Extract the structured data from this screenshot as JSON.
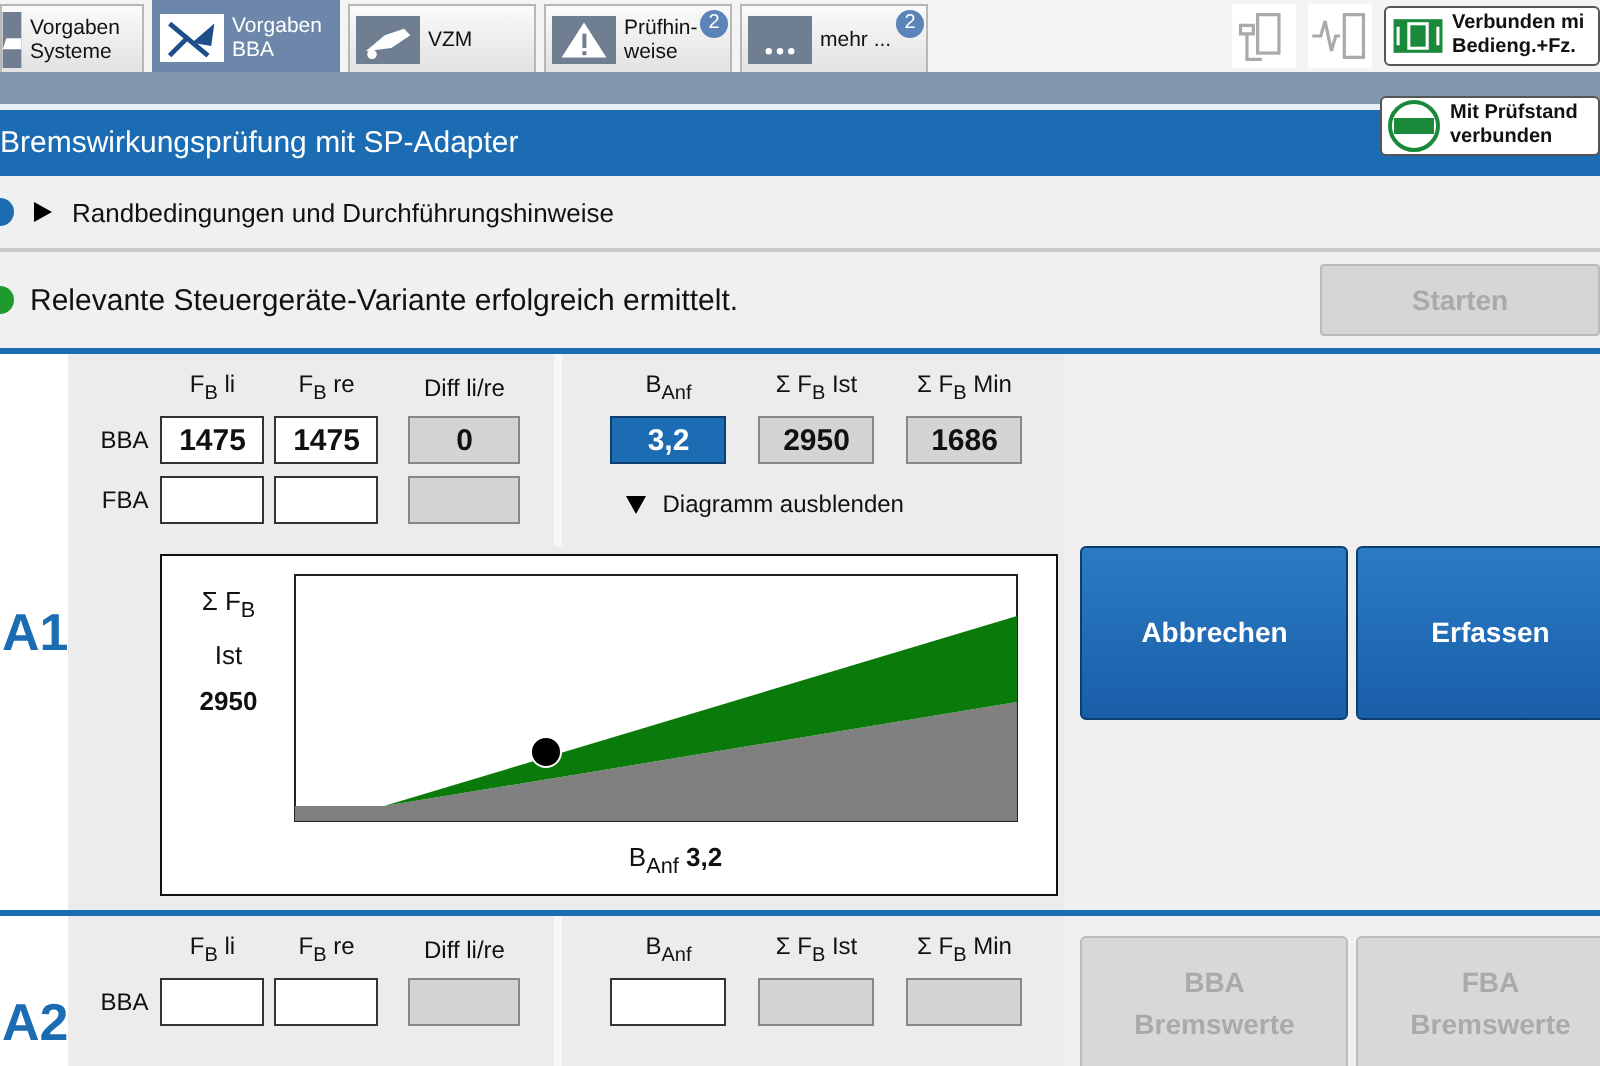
{
  "tabs": [
    {
      "lines": [
        "Vorgaben",
        "Systeme"
      ],
      "kind": "systems",
      "selected": false
    },
    {
      "lines": [
        "Vorgaben",
        "BBA"
      ],
      "kind": "brake",
      "selected": true
    },
    {
      "lines": [
        "VZM"
      ],
      "kind": "vzm",
      "selected": false
    },
    {
      "lines": [
        "Prüfhin-",
        "weise"
      ],
      "kind": "warning",
      "badge": "2",
      "selected": false
    },
    {
      "lines": [
        "mehr ..."
      ],
      "kind": "more",
      "badge": "2",
      "selected": false
    }
  ],
  "vehicle_connection": {
    "lines": [
      "Verbunden mi",
      "Bedieng.+Fz."
    ]
  },
  "title": "Bremswirkungsprüfung mit SP-Adapter",
  "bench_connection": {
    "lines": [
      "Mit Prüfstand",
      "verbunden"
    ]
  },
  "hints": {
    "label": "Randbedingungen und Durchführungshinweise",
    "expanded": false
  },
  "status": {
    "text": "Relevante Steuergeräte-Variante erfolgreich ermittelt.",
    "ok": true
  },
  "start_button": {
    "label": "Starten",
    "disabled": true
  },
  "sections": [
    {
      "label": "A1",
      "left_columns": [
        "F$_{B}$ li",
        "F$_{B}$ re",
        "Diff li/re"
      ],
      "right_columns": [
        "B$_{Anf}$",
        "Σ F$_{B}$ Ist",
        "Σ F$_{B}$ Min"
      ],
      "rows": [
        {
          "label": "BBA",
          "cells": [
            {
              "kind": "input",
              "value": "1475"
            },
            {
              "kind": "input",
              "value": "1475"
            },
            {
              "kind": "readonly",
              "value": "0"
            }
          ]
        },
        {
          "label": "FBA",
          "cells": [
            {
              "kind": "input"
            },
            {
              "kind": "input"
            },
            {
              "kind": "readonly"
            }
          ]
        }
      ],
      "totals": [
        {
          "kind": "input",
          "value": "3,2",
          "selected": true
        },
        {
          "kind": "readonly",
          "value": "2950",
          "selected": false
        },
        {
          "kind": "readonly",
          "value": "1686",
          "selected": false
        }
      ],
      "diagram": {
        "toggle": "Diagramm ausblenden",
        "expanded": true,
        "ylabel": [
          "Σ F$_{B}$",
          "Ist",
          "2950"
        ],
        "xlabel": "B$_{Anf}$ **3,2**"
      },
      "buttons": [
        {
          "lines": [
            "Abbrechen"
          ],
          "disabled": false
        },
        {
          "lines": [
            "Erfassen"
          ],
          "disabled": false
        }
      ]
    },
    {
      "label": "A2",
      "left_columns": [
        "F$_{B}$ li",
        "F$_{B}$ re",
        "Diff li/re"
      ],
      "right_columns": [
        "B$_{Anf}$",
        "Σ F$_{B}$ Ist",
        "Σ F$_{B}$ Min"
      ],
      "rows": [
        {
          "label": "BBA",
          "cells": [
            {
              "kind": "input"
            },
            {
              "kind": "input"
            },
            {
              "kind": "readonly"
            }
          ]
        }
      ],
      "totals": [
        {
          "kind": "input",
          "selected": false
        },
        {
          "kind": "readonly",
          "selected": false
        },
        {
          "kind": "readonly",
          "selected": false
        }
      ],
      "buttons": [
        {
          "lines": [
            "BBA",
            "Bremswerte"
          ],
          "disabled": true
        },
        {
          "lines": [
            "FBA",
            "Bremswerte"
          ],
          "disabled": true
        }
      ]
    }
  ]
}
